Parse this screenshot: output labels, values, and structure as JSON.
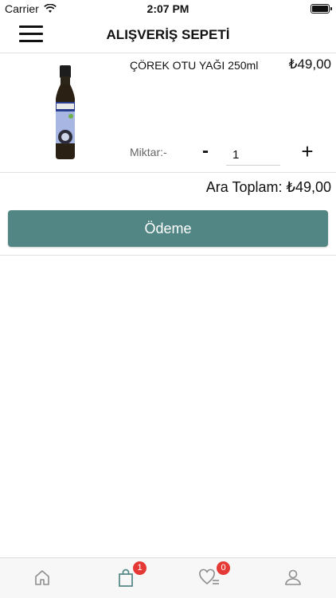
{
  "status_bar": {
    "carrier": "Carrier",
    "time": "2:07 PM"
  },
  "header": {
    "title": "ALIŞVERİŞ SEPETİ"
  },
  "cart": {
    "items": [
      {
        "name": "ÇÖREK OTU YAĞI 250ml",
        "price": "₺49,00",
        "quantity_label": "Miktar:-",
        "quantity": "1",
        "minus_label": "-",
        "plus_label": "+",
        "image_icon": "oil-bottle"
      }
    ],
    "subtotal": "Ara Toplam: ₺49,00",
    "checkout_label": "Ödeme"
  },
  "tabbar": {
    "tabs": [
      {
        "icon": "home-icon"
      },
      {
        "icon": "shopping-bag-icon",
        "badge": "1"
      },
      {
        "icon": "favorites-heart-icon",
        "badge": "0"
      },
      {
        "icon": "profile-icon"
      }
    ]
  },
  "colors": {
    "accent": "#528684",
    "badge": "#e53935",
    "tab_active": "#528684",
    "tab_inactive": "#8e8e8e"
  }
}
